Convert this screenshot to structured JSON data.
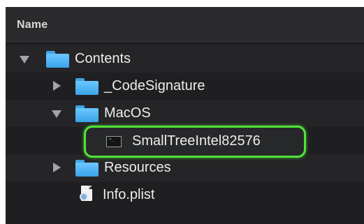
{
  "header": {
    "name_label": "Name"
  },
  "rows": [
    {
      "label": "Contents",
      "kind": "folder",
      "expanded": true,
      "icon": "folder-icon"
    },
    {
      "label": "_CodeSignature",
      "kind": "folder",
      "expanded": false,
      "icon": "folder-icon"
    },
    {
      "label": "MacOS",
      "kind": "folder",
      "expanded": true,
      "icon": "folder-icon"
    },
    {
      "label": "SmallTreeIntel82576",
      "kind": "executable",
      "highlighted": true,
      "icon": "terminal-executable-icon"
    },
    {
      "label": "Resources",
      "kind": "folder",
      "expanded": false,
      "icon": "folder-icon"
    },
    {
      "label": "Info.plist",
      "kind": "file",
      "icon": "plist-file-icon"
    }
  ],
  "colors": {
    "background": "#1f1f21",
    "folder": "#4fb4f6",
    "highlight_outline": "#52e23b",
    "text": "#ececec"
  }
}
